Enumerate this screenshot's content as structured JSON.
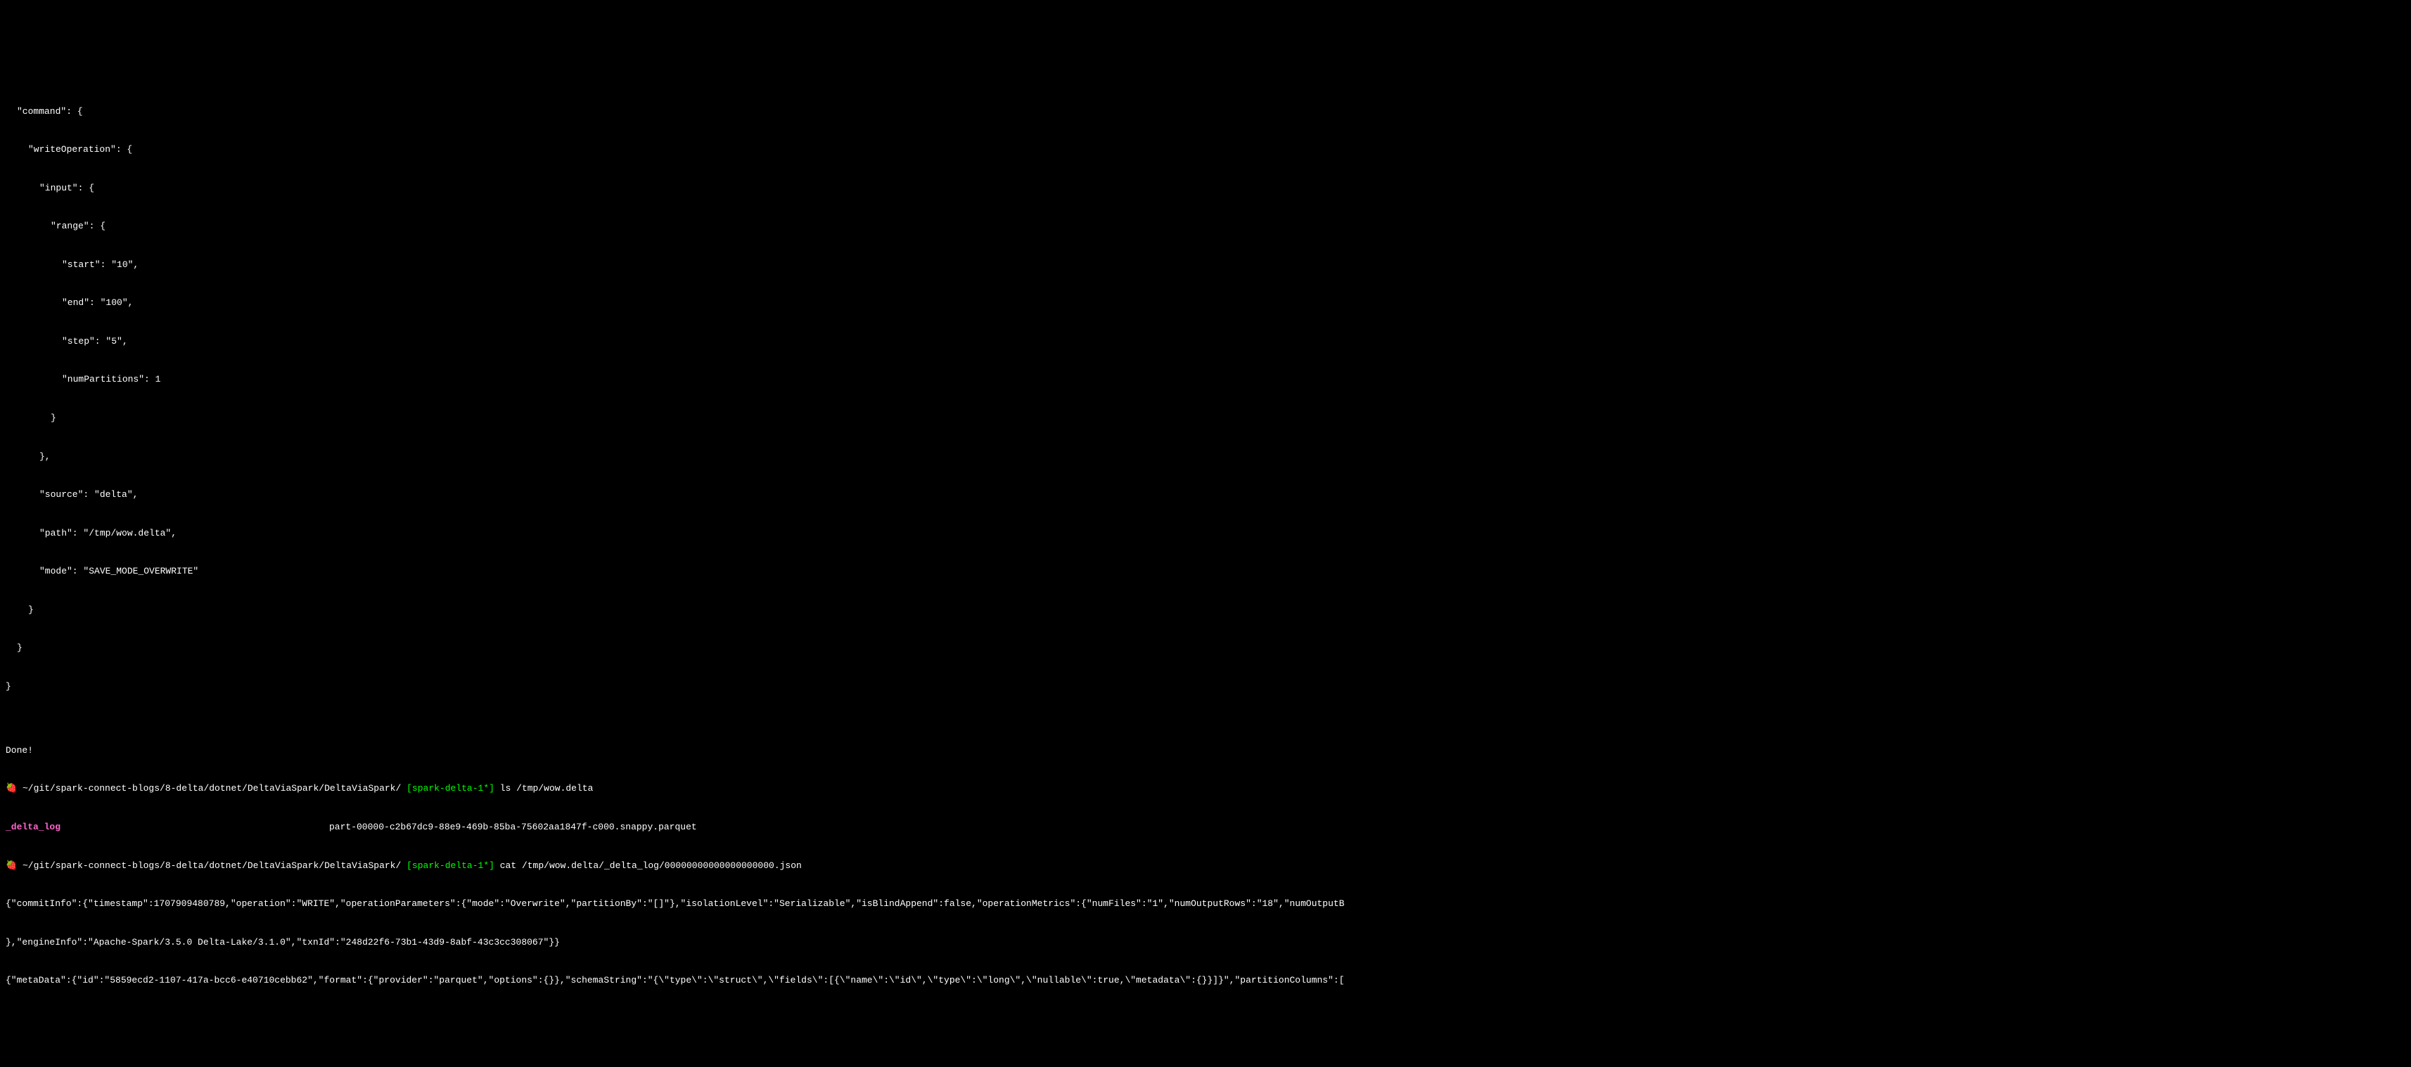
{
  "json_output": {
    "lines": [
      {
        "indent": 1,
        "text": "\"command\": {"
      },
      {
        "indent": 2,
        "text": "\"writeOperation\": {"
      },
      {
        "indent": 3,
        "text": "\"input\": {"
      },
      {
        "indent": 4,
        "text": "\"range\": {"
      },
      {
        "indent": 5,
        "text": "\"start\": \"10\","
      },
      {
        "indent": 5,
        "text": "\"end\": \"100\","
      },
      {
        "indent": 5,
        "text": "\"step\": \"5\","
      },
      {
        "indent": 5,
        "text": "\"numPartitions\": 1"
      },
      {
        "indent": 4,
        "text": "}"
      },
      {
        "indent": 3,
        "text": "},"
      },
      {
        "indent": 3,
        "text": "\"source\": \"delta\","
      },
      {
        "indent": 3,
        "text": "\"path\": \"/tmp/wow.delta\","
      },
      {
        "indent": 3,
        "text": "\"mode\": \"SAVE_MODE_OVERWRITE\""
      },
      {
        "indent": 2,
        "text": "}"
      },
      {
        "indent": 1,
        "text": "}"
      },
      {
        "indent": 0,
        "text": "}"
      }
    ]
  },
  "done_text": "Done!",
  "prompt1": {
    "icon": "🍓",
    "path": "~/git/spark-connect-blogs/8-delta/dotnet/DeltaViaSpark/DeltaViaSpark/",
    "branch": "[spark-delta-1*]",
    "command": "ls /tmp/wow.delta"
  },
  "ls_output": {
    "col1": "_delta_log",
    "col2": "part-00000-c2b67dc9-88e9-469b-85ba-75602aa1847f-c000.snappy.parquet"
  },
  "prompt2": {
    "icon": "🍓",
    "path": "~/git/spark-connect-blogs/8-delta/dotnet/DeltaViaSpark/DeltaViaSpark/",
    "branch": "[spark-delta-1*]",
    "command": "cat /tmp/wow.delta/_delta_log/00000000000000000000.json"
  },
  "json_lines": {
    "line1": "{\"commitInfo\":{\"timestamp\":1707909480789,\"operation\":\"WRITE\",\"operationParameters\":{\"mode\":\"Overwrite\",\"partitionBy\":\"[]\"},\"isolationLevel\":\"Serializable\",\"isBlindAppend\":false,\"operationMetrics\":{\"numFiles\":\"1\",\"numOutputRows\":\"18\",\"numOutputB",
    "line2": "},\"engineInfo\":\"Apache-Spark/3.5.0 Delta-Lake/3.1.0\",\"txnId\":\"248d22f6-73b1-43d9-8abf-43c3cc308067\"}}",
    "line3": "{\"metaData\":{\"id\":\"5859ecd2-1107-417a-bcc6-e40710cebb62\",\"format\":{\"provider\":\"parquet\",\"options\":{}},\"schemaString\":\"{\\\"type\\\":\\\"struct\\\",\\\"fields\\\":[{\\\"name\\\":\\\"id\\\",\\\"type\\\":\\\"long\\\",\\\"nullable\\\":true,\\\"metadata\\\":{}}]}\",\"partitionColumns\":["
  }
}
